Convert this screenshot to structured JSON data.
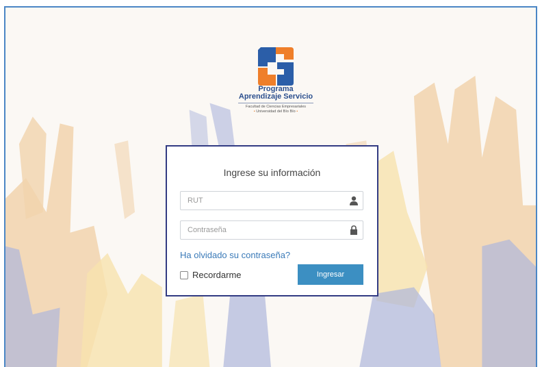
{
  "logo": {
    "title_line1": "Programa",
    "title_line2": "Aprendizaje Servicio",
    "subtitle_line1": "Facultad de Ciencias Empresariales",
    "subtitle_line2": "Universidad del Bío Bío",
    "bullet": "•"
  },
  "login": {
    "heading": "Ingrese su información",
    "rut_placeholder": "RUT",
    "rut_value": "",
    "password_placeholder": "Contraseña",
    "password_value": "",
    "forgot_link": "Ha olvidado su contraseña?",
    "remember_label": "Recordarme",
    "remember_checked": false,
    "submit_label": "Ingresar"
  },
  "icons": {
    "user": "user-icon",
    "lock": "lock-icon"
  },
  "colors": {
    "frame_border": "#4a86c5",
    "card_border": "#313a82",
    "button": "#3c8fc2",
    "link": "#3a7ab8",
    "logo_blue": "#2b5ea8",
    "logo_orange": "#ef7f2a",
    "hand_orange": "#f1d3ad",
    "hand_yellow": "#f7e2ae",
    "hand_blue": "#aeb6dc"
  }
}
